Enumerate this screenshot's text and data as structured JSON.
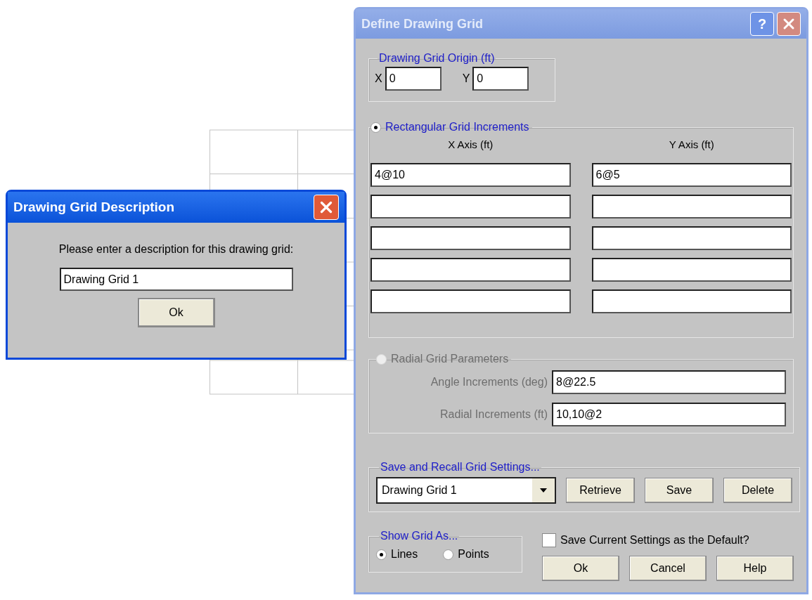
{
  "main_dialog": {
    "title": "Define Drawing Grid",
    "help_button": "?",
    "origin": {
      "legend": "Drawing Grid Origin (ft)",
      "x_label": "X",
      "x_value": "0",
      "y_label": "Y",
      "y_value": "0"
    },
    "rectangular": {
      "label": "Rectangular Grid Increments",
      "selected": true,
      "x_header": "X Axis (ft)",
      "y_header": "Y Axis (ft)",
      "rows": [
        {
          "x": "4@10",
          "y": "6@5"
        },
        {},
        {},
        {},
        {}
      ]
    },
    "radial": {
      "label": "Radial Grid Parameters",
      "selected": false,
      "disabled": true,
      "angle_label": "Angle Increments (deg)",
      "angle_value": "8@22.5",
      "radial_label": "Radial Increments (ft)",
      "radial_value": "10,10@2"
    },
    "save_recall": {
      "legend": "Save and Recall Grid Settings...",
      "selected_setting": "Drawing Grid 1",
      "buttons": [
        "Retrieve",
        "Save",
        "Delete"
      ]
    },
    "show_as": {
      "legend": "Show Grid As...",
      "options": [
        {
          "label": "Lines",
          "selected": true
        },
        {
          "label": "Points",
          "selected": false
        }
      ]
    },
    "default_checkbox": {
      "label": "Save Current Settings as the Default?",
      "checked": false
    },
    "buttons": [
      "Ok",
      "Cancel",
      "Help"
    ]
  },
  "description_dialog": {
    "title": "Drawing Grid Description",
    "prompt": "Please enter a description for this drawing grid:",
    "value": "Drawing Grid 1",
    "button": "Ok"
  }
}
